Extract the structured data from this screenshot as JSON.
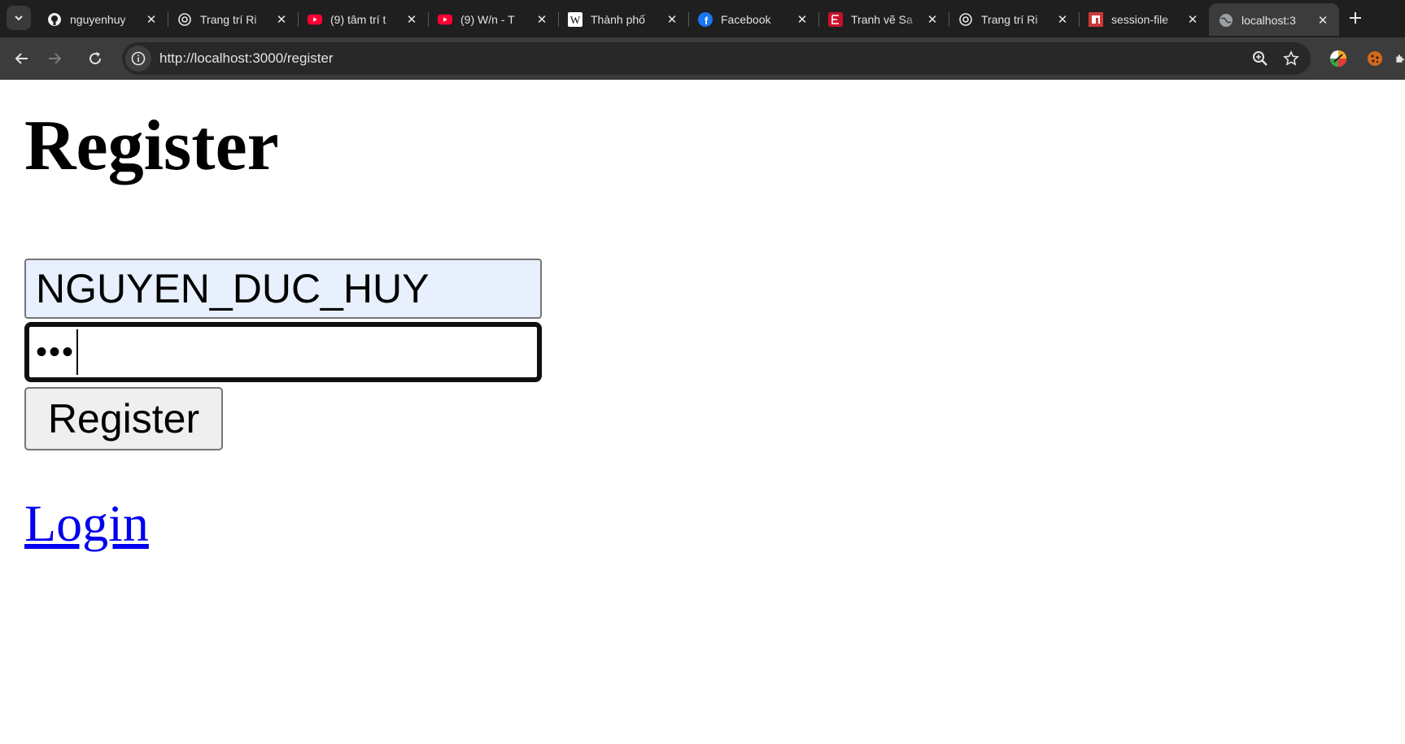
{
  "browser": {
    "tabs": [
      {
        "title": "nguyenhuy",
        "favicon": "github-icon",
        "active": false
      },
      {
        "title": "Trang trí Ri",
        "favicon": "chatgpt-icon",
        "active": false
      },
      {
        "title": "(9) tâm trí t",
        "favicon": "youtube-icon",
        "active": false
      },
      {
        "title": "(9) W/n - T",
        "favicon": "youtube-icon",
        "active": false
      },
      {
        "title": "Thành phố",
        "favicon": "wikipedia-icon",
        "active": false
      },
      {
        "title": "Facebook",
        "favicon": "facebook-icon",
        "active": false
      },
      {
        "title": "Tranh vẽ Sa",
        "favicon": "app-e-icon",
        "active": false
      },
      {
        "title": "Trang trí Ri",
        "favicon": "chatgpt-icon",
        "active": false
      },
      {
        "title": "session-file",
        "favicon": "npm-icon",
        "active": false
      },
      {
        "title": "localhost:3",
        "favicon": "globe-icon",
        "active": true
      }
    ],
    "url": "http://localhost:3000/register",
    "colors": {
      "tabbar": "#1f1f1f",
      "toolbar": "#3c3c3c",
      "omnibox": "#282828"
    }
  },
  "page": {
    "title": "Register",
    "username_value": "NGUYEN_DUC_HUY",
    "password_masked": "•••",
    "register_button": "Register",
    "login_link": "Login",
    "colors": {
      "autofill_bg": "#e8f0fe",
      "link": "#0000ee",
      "button_bg": "#efefef"
    }
  }
}
